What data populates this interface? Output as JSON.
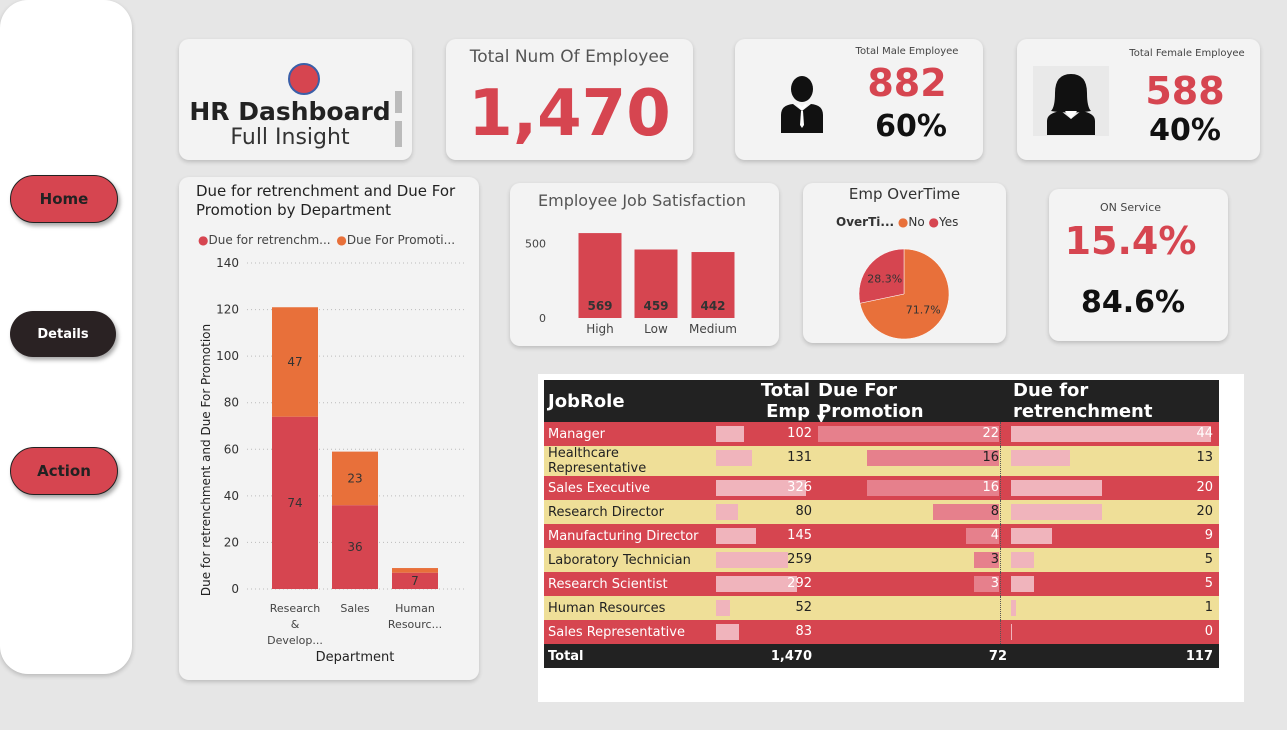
{
  "nav": {
    "home": "Home",
    "details": "Details",
    "action": "Action"
  },
  "title_card": {
    "title": "HR Dashboard",
    "subtitle": "Full Insight"
  },
  "total_emp": {
    "label": "Total Num Of Employee",
    "value": "1,470"
  },
  "male": {
    "label": "Total Male Employee",
    "value": "882",
    "pct": "60%"
  },
  "female": {
    "label": "Total Female Employee",
    "value": "588",
    "pct": "40%"
  },
  "on_service": {
    "label": "ON Service",
    "value": "15.4%",
    "other": "84.6%"
  },
  "colors": {
    "accent_red": "#d64550",
    "orange": "#e8703a",
    "dark": "#222222",
    "yellow": "#efdf98",
    "pink": "#f0b4bc"
  },
  "chart_data": [
    {
      "type": "bar",
      "title": "Due for retrenchment and Due For Promotion by Department",
      "legend": [
        "Due for retrenchm...",
        "Due For Promoti..."
      ],
      "categories": [
        "Research & Develop...",
        "Sales",
        "Human Resourc..."
      ],
      "series": [
        {
          "name": "Due for retrenchment",
          "values": [
            74,
            36,
            7
          ],
          "color": "#d64550"
        },
        {
          "name": "Due For Promotion",
          "values": [
            47,
            23,
            2
          ],
          "color": "#e8703a"
        }
      ],
      "xlabel": "Department",
      "ylabel": "Due for retrenchment and Due For Promotion",
      "yticks": [
        "0",
        "20",
        "40",
        "60",
        "80",
        "100",
        "120",
        "140"
      ],
      "ylim": [
        0,
        140
      ],
      "data_labels": [
        "74",
        "47",
        "36",
        "23",
        "7"
      ],
      "stacked": true,
      "grid": true
    },
    {
      "type": "bar",
      "title": "Employee Job Satisfaction",
      "categories": [
        "High",
        "Low",
        "Medium"
      ],
      "values": [
        569,
        459,
        442
      ],
      "data_labels": [
        "569",
        "459",
        "442"
      ],
      "yticks": [
        "0",
        "500"
      ],
      "ylim": [
        0,
        650
      ]
    },
    {
      "type": "pie",
      "title": "Emp OverTime",
      "legend_title": "OverTi...",
      "legend": [
        "No",
        "Yes"
      ],
      "categories": [
        "No",
        "Yes"
      ],
      "values": [
        71.7,
        28.3
      ],
      "labels": [
        "71.7%",
        "28.3%"
      ],
      "colors": [
        "#e8703a",
        "#d64550"
      ]
    }
  ],
  "table": {
    "headers": [
      "JobRole",
      "Total Emp",
      "Due For Promotion",
      "Due for retrenchment"
    ],
    "sort_icon": "triangle-down-icon",
    "rows": [
      {
        "role": "Manager",
        "total": 102,
        "promo": 22,
        "retr": 44
      },
      {
        "role": "Healthcare Representative",
        "total": 131,
        "promo": 16,
        "retr": 13
      },
      {
        "role": "Sales Executive",
        "total": 326,
        "promo": 16,
        "retr": 20
      },
      {
        "role": "Research Director",
        "total": 80,
        "promo": 8,
        "retr": 20
      },
      {
        "role": "Manufacturing Director",
        "total": 145,
        "promo": 4,
        "retr": 9
      },
      {
        "role": "Laboratory Technician",
        "total": 259,
        "promo": 3,
        "retr": 5
      },
      {
        "role": "Research Scientist",
        "total": 292,
        "promo": 3,
        "retr": 5
      },
      {
        "role": "Human Resources",
        "total": 52,
        "promo": "",
        "retr": 1
      },
      {
        "role": "Sales Representative",
        "total": 83,
        "promo": "",
        "retr": 0
      }
    ],
    "total": {
      "label": "Total",
      "total": "1,470",
      "promo": "72",
      "retr": "117"
    }
  }
}
